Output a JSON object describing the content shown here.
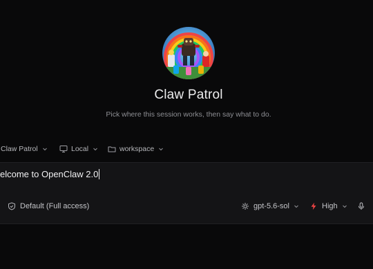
{
  "session": {
    "title": "Claw Patrol",
    "subtitle": "Pick where this session works, then say what to do."
  },
  "selectors": {
    "project": "Claw Patrol",
    "location": "Local",
    "folder": "workspace"
  },
  "composer": {
    "value": "elcome to OpenClaw 2.0"
  },
  "footer": {
    "permissions": "Default (Full access)",
    "model": "gpt-5.6-sol",
    "effort": "High"
  },
  "colors": {
    "background": "#09090a",
    "composer": "#141416",
    "effort_accent": "#ef4444"
  },
  "icons": {
    "location": "monitor-icon",
    "folder": "folder-icon",
    "permissions": "shield-icon",
    "model": "model-icon",
    "effort": "lightning-icon",
    "mic": "mic-icon"
  }
}
